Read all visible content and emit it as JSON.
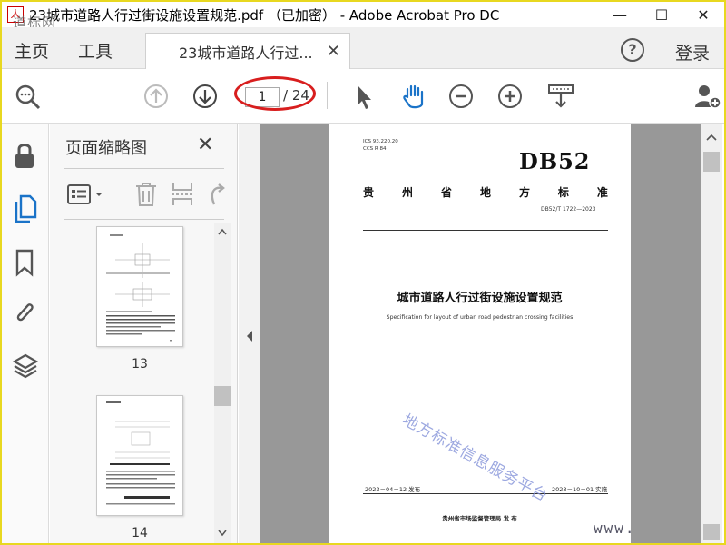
{
  "window": {
    "title": "23城市道路人行过街设施设置规范.pdf （已加密） - Adobe Acrobat Pro DC",
    "minimize": "—",
    "maximize": "☐",
    "close": "✕"
  },
  "watermark_top_left": "道标网",
  "tabs": {
    "home": "主页",
    "tools": "工具",
    "document": "23城市道路人行过...",
    "close": "✕",
    "help": "?",
    "login": "登录"
  },
  "toolbar": {
    "current_page": "1",
    "total_pages": "/ 24"
  },
  "thumbnail_panel": {
    "title": "页面缩略图",
    "close": "✕",
    "thumbnails": [
      {
        "label": "13"
      },
      {
        "label": "14"
      }
    ]
  },
  "document_page": {
    "ics": "ICS  93.220.20",
    "ccs": "CCS R 84",
    "db": "DB52",
    "province_chars": [
      "贵",
      "州",
      "省",
      "地",
      "方",
      "标",
      "准"
    ],
    "code": "DB52/T 1722—2023",
    "title": "城市道路人行过街设施设置规范",
    "subtitle": "Specification for layout of urban road pedestrian crossing facilities",
    "release_date": "2023－04－12 发布",
    "implement_date": "2023－10－01 实施",
    "issuer": "贵州省市场监督管理局    发  布"
  },
  "watermark_diagonal": "地方标准信息服务平台",
  "watermark_www": "www."
}
